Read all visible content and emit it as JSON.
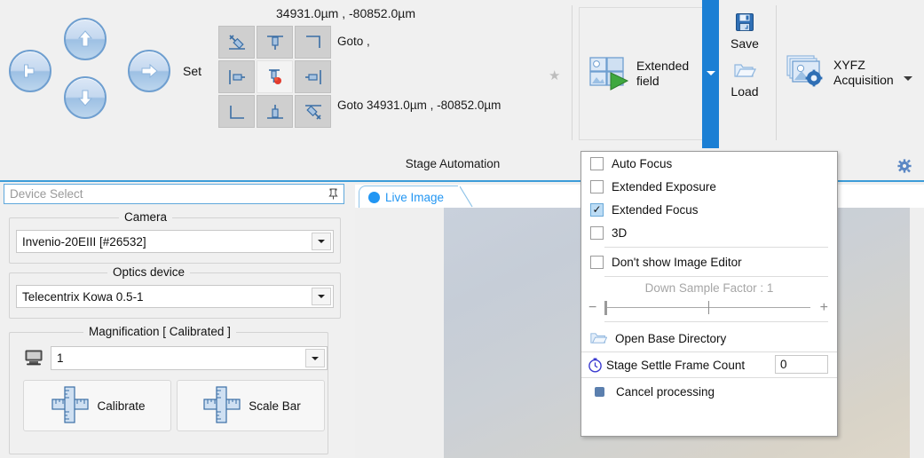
{
  "ribbon": {
    "stage": {
      "coordinate_readout": "34931.0µm , -80852.0µm",
      "set_label": "Set",
      "goto_top_label": "Goto  ,",
      "goto_bottom_label": "Goto  34931.0µm , -80852.0µm",
      "grid_buttons": [
        {
          "name": "set-top-left",
          "icon": "pin-top-left-icon"
        },
        {
          "name": "set-top-center",
          "icon": "pin-top-center-icon"
        },
        {
          "name": "set-top-right",
          "icon": "corner-top-right-icon"
        },
        {
          "name": "set-middle-left",
          "icon": "pin-left-icon"
        },
        {
          "name": "set-center",
          "icon": "pin-center-red-icon"
        },
        {
          "name": "set-middle-right",
          "icon": "pin-right-icon"
        },
        {
          "name": "set-bottom-left",
          "icon": "corner-bottom-left-icon"
        },
        {
          "name": "set-bottom-center",
          "icon": "pin-bottom-center-icon"
        },
        {
          "name": "set-bottom-right",
          "icon": "pin-bottom-right-icon"
        }
      ],
      "favorite_icon": "star-icon"
    },
    "extended_field": {
      "label_line1": "Extended",
      "label_line2": "field",
      "icon": "extended-field-icon",
      "dropdown_icon": "chevron-down-icon"
    },
    "save_load": {
      "save_label": "Save",
      "save_icon": "floppy-disk-icon",
      "load_label": "Load",
      "load_icon": "folder-open-icon"
    },
    "xyfz": {
      "label_line1": "XYFZ",
      "label_line2": "Acquisition",
      "icon": "image-stack-gear-icon",
      "dropdown_icon": "chevron-down-icon"
    },
    "footer_title": "Stage Automation",
    "settings_icon": "gear-icon"
  },
  "left_panel": {
    "device_select_title": "Device Select",
    "pin_icon": "pin-icon",
    "camera": {
      "group_title": "Camera",
      "value": "Invenio-20EIII  [#26532]"
    },
    "optics": {
      "group_title": "Optics device",
      "value": "Telecentrix Kowa 0.5-1"
    },
    "magnification": {
      "group_title": "Magnification [ Calibrated ]",
      "value": "1",
      "monitor_icon": "monitor-icon",
      "calibrate_label": "Calibrate",
      "calibrate_icon": "ruler-cross-icon",
      "scale_bar_label": "Scale Bar",
      "scale_bar_icon": "ruler-cross-icon"
    }
  },
  "center": {
    "tab_label": "Live Image",
    "tab_dot_icon": "record-dot-icon"
  },
  "menu": {
    "items": [
      {
        "label": "Auto Focus",
        "checked": false
      },
      {
        "label": "Extended Exposure",
        "checked": false
      },
      {
        "label": "Extended Focus",
        "checked": true
      },
      {
        "label": "3D",
        "checked": false
      },
      {
        "label": "Don't show Image Editor",
        "checked": false
      }
    ],
    "down_sample": {
      "label": "Down Sample Factor : 1",
      "value": 1,
      "min_icon": "minus-icon",
      "max_icon": "plus-icon"
    },
    "open_base_directory": {
      "label": "Open Base Directory",
      "icon": "folder-open-icon"
    },
    "stage_settle": {
      "label": "Stage Settle Frame Count",
      "value": "0",
      "icon": "stopwatch-icon"
    },
    "cancel_processing": {
      "label": "Cancel processing",
      "icon": "stop-square-icon"
    }
  },
  "colors": {
    "accent_blue": "#1b7fd4",
    "tab_blue": "#2196f3",
    "rule_blue": "#3c9cd8",
    "panel_bg": "#f0f0f0"
  }
}
